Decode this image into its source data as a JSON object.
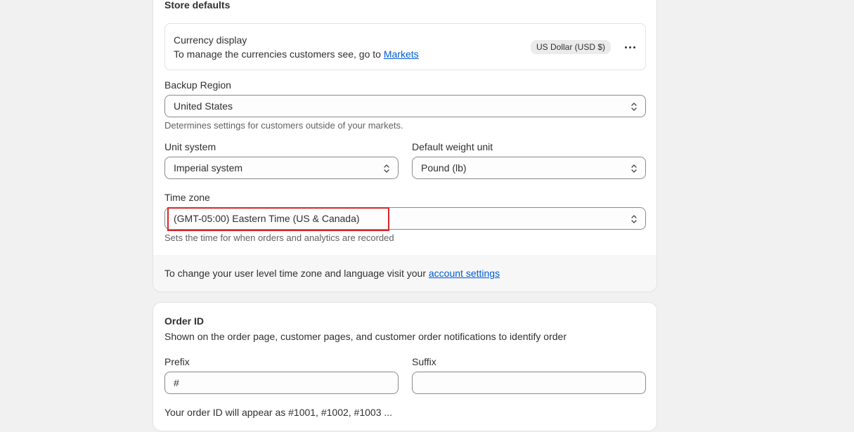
{
  "store_defaults": {
    "title": "Store defaults",
    "currency": {
      "title": "Currency display",
      "description": "To manage the currencies customers see, go to ",
      "link": "Markets",
      "badge": "US Dollar (USD $)"
    },
    "backup_region": {
      "label": "Backup Region",
      "value": "United States",
      "help": "Determines settings for customers outside of your markets."
    },
    "unit_system": {
      "label": "Unit system",
      "value": "Imperial system"
    },
    "weight_unit": {
      "label": "Default weight unit",
      "value": "Pound (lb)"
    },
    "time_zone": {
      "label": "Time zone",
      "value": "(GMT-05:00) Eastern Time (US & Canada)",
      "help": "Sets the time for when orders and analytics are recorded"
    },
    "footer": {
      "text": "To change your user level time zone and language visit your ",
      "link": "account settings"
    }
  },
  "order_id": {
    "title": "Order ID",
    "description": "Shown on the order page, customer pages, and customer order notifications to identify order",
    "prefix": {
      "label": "Prefix",
      "value": "#"
    },
    "suffix": {
      "label": "Suffix",
      "value": ""
    },
    "preview": "Your order ID will appear as #1001, #1002, #1003 ..."
  },
  "colors": {
    "link": "#005bd3",
    "highlight": "#d9262c",
    "badge_bg": "#ebebeb"
  },
  "icons": [
    "more-horizontal-icon",
    "select-chevron-icon"
  ]
}
